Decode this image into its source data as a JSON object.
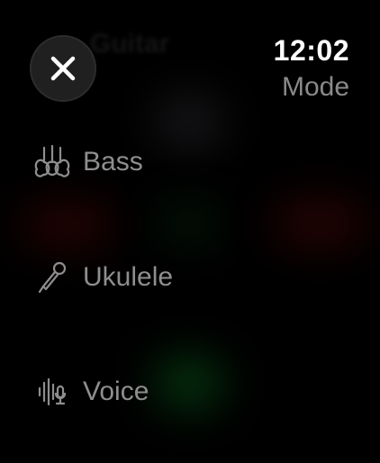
{
  "status": {
    "time": "12:02"
  },
  "header": {
    "title": "Mode",
    "background_title": "Guitar"
  },
  "close_button": {
    "icon": "close-icon"
  },
  "modes": [
    {
      "label": "Bass",
      "icon": "bass-guitars-icon"
    },
    {
      "label": "Ukulele",
      "icon": "microphone-icon"
    },
    {
      "label": "Voice",
      "icon": "voice-waveform-icon"
    }
  ],
  "colors": {
    "background": "#000000",
    "text_primary": "#FFFFFF",
    "text_secondary": "#8E8E8E",
    "button": "#202020"
  }
}
